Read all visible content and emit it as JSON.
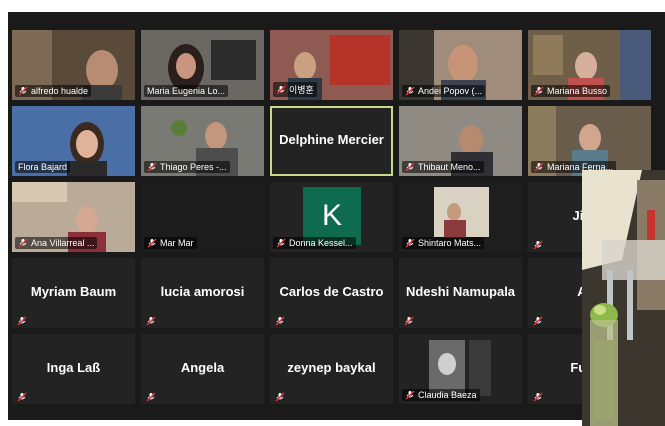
{
  "participants": [
    {
      "name": "alfredo hualde",
      "display": "video",
      "muted": true
    },
    {
      "name": "Maria Eugenia Lo...",
      "display": "video",
      "muted": false
    },
    {
      "name": "이병훈",
      "display": "video",
      "muted": true
    },
    {
      "name": "Andei Popov (...",
      "display": "video",
      "muted": true
    },
    {
      "name": "Mariana Busso",
      "display": "video",
      "muted": true
    },
    {
      "name": "Flora Bajard",
      "display": "video",
      "muted": false
    },
    {
      "name": "Thiago Peres -...",
      "display": "video",
      "muted": true
    },
    {
      "name": "Delphine Mercier",
      "display": "name",
      "muted": false,
      "active": true
    },
    {
      "name": "Thibaut Meno...",
      "display": "video",
      "muted": true
    },
    {
      "name": "Mariana Ferna...",
      "display": "video",
      "muted": true
    },
    {
      "name": "Ana Villarreal ...",
      "display": "video",
      "muted": true
    },
    {
      "name": "Mar Mar",
      "display": "video",
      "muted": true
    },
    {
      "name": "Donna Kessel...",
      "display": "avatar",
      "avatar_letter": "K",
      "muted": true
    },
    {
      "name": "Shintaro Mats...",
      "display": "video",
      "muted": true
    },
    {
      "name": "Jiyou",
      "display": "name",
      "muted": true
    },
    {
      "name": "Myriam Baum",
      "display": "name",
      "muted": true
    },
    {
      "name": "lucia amorosi",
      "display": "name",
      "muted": true
    },
    {
      "name": "Carlos de Castro",
      "display": "name",
      "muted": true
    },
    {
      "name": "Ndeshi Namupala",
      "display": "name",
      "muted": true
    },
    {
      "name": "Ada",
      "display": "name",
      "muted": true
    },
    {
      "name": "Inga Laß",
      "display": "name",
      "muted": true
    },
    {
      "name": "Angela",
      "display": "name",
      "muted": true
    },
    {
      "name": "zeynep baykal",
      "display": "name",
      "muted": true
    },
    {
      "name": "Claudia Baeza",
      "display": "video",
      "muted": true
    },
    {
      "name": "Fumik",
      "display": "name",
      "muted": true
    }
  ],
  "colors": {
    "muted_icon": "#e0353a",
    "active_border": "#c9d98a",
    "tile_bg": "#232323",
    "avatar_bg": "#0e6b4e"
  }
}
